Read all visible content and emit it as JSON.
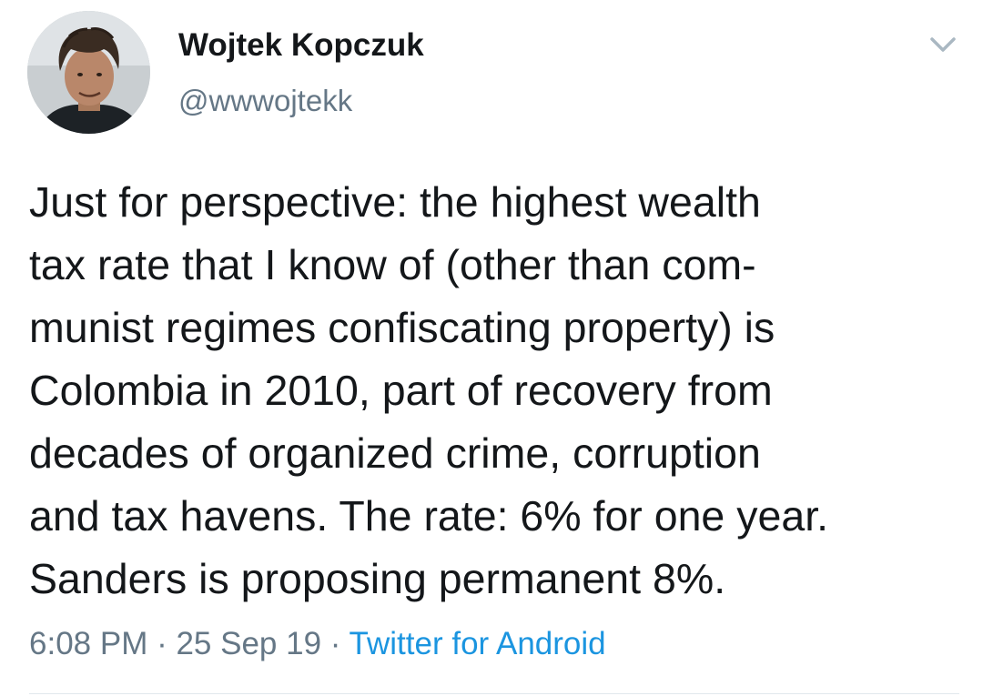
{
  "author": {
    "display_name": "Wojtek Kopczuk",
    "handle": "@wwwojtekk"
  },
  "tweet": {
    "lines": [
      "Just for perspective: the highest wealth",
      "tax rate that I know of (other than com-",
      "munist regimes confiscating property) is",
      "Colombia in 2010, part of recovery from",
      "decades of organized crime, corruption",
      "and tax havens. The rate: 6% for one year.",
      "Sanders is proposing permanent 8%."
    ],
    "time": "6:08 PM",
    "separator": " · ",
    "date": "25 Sep 19",
    "source": "Twitter for Android"
  },
  "icons": {
    "menu": "chevron-down-icon",
    "avatar": "profile-photo"
  },
  "colors": {
    "text": "#14171a",
    "secondary": "#657786",
    "link": "#1b95e0",
    "divider": "#e1e8ed"
  }
}
